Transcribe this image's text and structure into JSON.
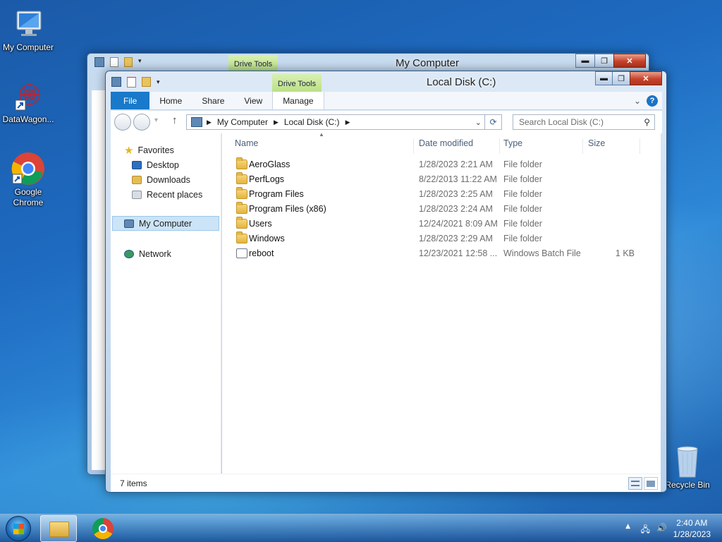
{
  "desktop": {
    "icons": [
      {
        "label": "My Computer"
      },
      {
        "label": "DataWagon..."
      },
      {
        "label": "Google Chrome"
      },
      {
        "label": "Recycle Bin"
      }
    ]
  },
  "back_window": {
    "title": "My Computer",
    "contextual_tab": "Drive Tools",
    "controls": {
      "minimize": "▬",
      "maximize": "❐",
      "close": "✕"
    }
  },
  "window": {
    "title": "Local Disk (C:)",
    "contextual_tab": "Drive Tools",
    "controls": {
      "minimize": "▬",
      "maximize": "❐",
      "close": "✕"
    },
    "ribbon_tabs": [
      "File",
      "Home",
      "Share",
      "View",
      "Manage"
    ],
    "breadcrumb": [
      "My Computer",
      "Local Disk (C:)"
    ],
    "search_placeholder": "Search Local Disk (C:)",
    "nav": {
      "favorites_label": "Favorites",
      "favorites": [
        "Desktop",
        "Downloads",
        "Recent places"
      ],
      "my_computer": "My Computer",
      "network": "Network"
    },
    "columns": [
      "Name",
      "Date modified",
      "Type",
      "Size"
    ],
    "rows": [
      {
        "name": "AeroGlass",
        "date": "1/28/2023 2:21 AM",
        "type": "File folder",
        "size": "",
        "kind": "folder"
      },
      {
        "name": "PerfLogs",
        "date": "8/22/2013 11:22 AM",
        "type": "File folder",
        "size": "",
        "kind": "folder"
      },
      {
        "name": "Program Files",
        "date": "1/28/2023 2:25 AM",
        "type": "File folder",
        "size": "",
        "kind": "folder"
      },
      {
        "name": "Program Files (x86)",
        "date": "1/28/2023 2:24 AM",
        "type": "File folder",
        "size": "",
        "kind": "folder"
      },
      {
        "name": "Users",
        "date": "12/24/2021 8:09 AM",
        "type": "File folder",
        "size": "",
        "kind": "folder"
      },
      {
        "name": "Windows",
        "date": "1/28/2023 2:29 AM",
        "type": "File folder",
        "size": "",
        "kind": "folder"
      },
      {
        "name": "reboot",
        "date": "12/23/2021 12:58 ...",
        "type": "Windows Batch File",
        "size": "1 KB",
        "kind": "batch"
      }
    ],
    "status": "7 items"
  },
  "taskbar": {
    "time": "2:40 AM",
    "date": "1/28/2023"
  }
}
